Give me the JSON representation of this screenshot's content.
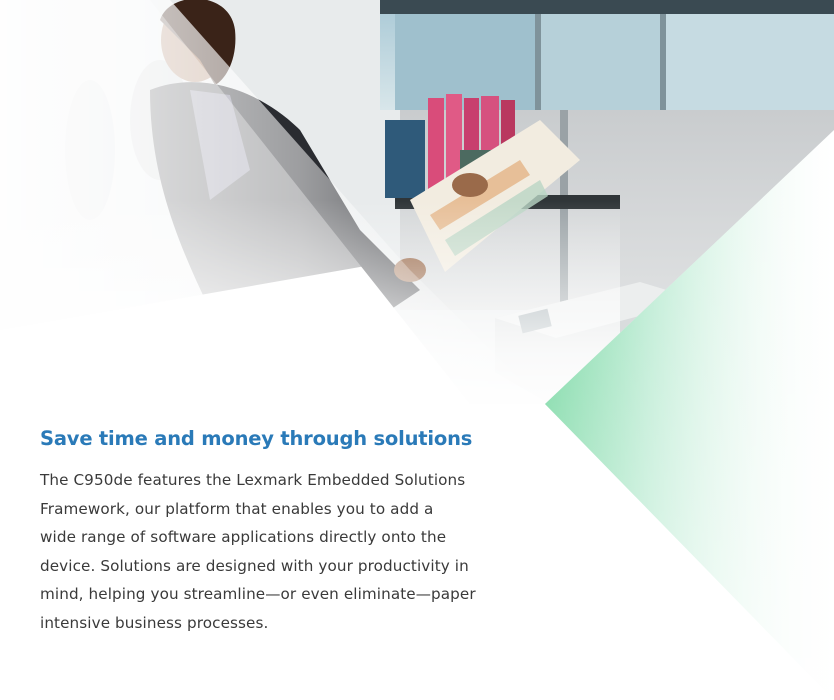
{
  "colors": {
    "heading": "#2a7ab8",
    "body_text": "#3a3a3a",
    "accent_green": "#6cd49a",
    "background": "#ffffff"
  },
  "photo": {
    "description_icon": "office-woman-printer-photo"
  },
  "content": {
    "heading": "Save time and money through solutions",
    "paragraph_lines": [
      "The C950de features the Lexmark Embedded Solutions",
      "Framework, our platform that enables you to add a",
      "wide range of software applications directly onto the",
      "device. Solutions are designed with your productivity in",
      "mind, helping you streamline—or even eliminate—paper",
      "intensive business processes."
    ]
  }
}
